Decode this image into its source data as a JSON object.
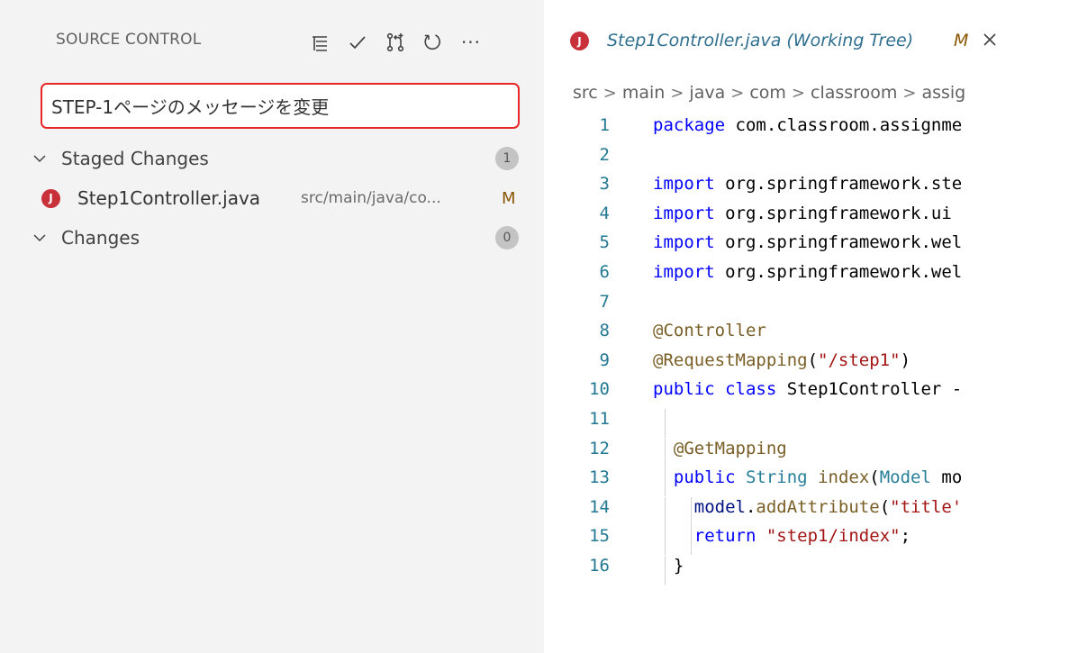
{
  "source_control": {
    "title": "SOURCE CONTROL",
    "actions": [
      {
        "icon": "view-as-tree-icon"
      },
      {
        "icon": "commit-check-icon"
      },
      {
        "icon": "pull-request-icon"
      },
      {
        "icon": "refresh-icon"
      },
      {
        "icon": "more-actions-icon",
        "glyph": "···"
      }
    ],
    "commit_message": "STEP-1ページのメッセージを変更",
    "staged": {
      "label": "Staged Changes",
      "count": "1",
      "files": [
        {
          "icon": "J",
          "name": "Step1Controller.java",
          "path": "src/main/java/co...",
          "status": "M"
        }
      ]
    },
    "changes": {
      "label": "Changes",
      "count": "0"
    }
  },
  "editor": {
    "tab": {
      "icon": "J",
      "title": "Step1Controller.java (Working Tree)",
      "status": "M",
      "close": "×"
    },
    "breadcrumb": [
      "src",
      "main",
      "java",
      "com",
      "classroom",
      "assig"
    ],
    "breadcrumb_separator": ">",
    "lines": [
      {
        "n": "1",
        "text": "package com.classroom.assignme"
      },
      {
        "n": "2",
        "text": ""
      },
      {
        "n": "3",
        "text": "import org.springframework.ste"
      },
      {
        "n": "4",
        "text": "import org.springframework.ui"
      },
      {
        "n": "5",
        "text": "import org.springframework.wel"
      },
      {
        "n": "6",
        "text": "import org.springframework.wel"
      },
      {
        "n": "7",
        "text": ""
      },
      {
        "n": "8",
        "text": "@Controller"
      },
      {
        "n": "9",
        "text": "@RequestMapping(\"/step1\")"
      },
      {
        "n": "10",
        "text": "public class Step1Controller -"
      },
      {
        "n": "11",
        "text": ""
      },
      {
        "n": "12",
        "text": "  @GetMapping"
      },
      {
        "n": "13",
        "text": "  public String index(Model mo"
      },
      {
        "n": "14",
        "text": "    model.addAttribute(\"title'"
      },
      {
        "n": "15",
        "text": "    return \"step1/index\";"
      },
      {
        "n": "16",
        "text": "  }"
      }
    ]
  },
  "colors": {
    "panel_bg": "#f3f3f3",
    "input_border": "#e82828",
    "java_icon": "#c8303a",
    "modified": "#895503",
    "keyword": "#0000ff",
    "string": "#a31515",
    "annotation": "#795e26",
    "type": "#267f99",
    "line_number": "#237893"
  }
}
